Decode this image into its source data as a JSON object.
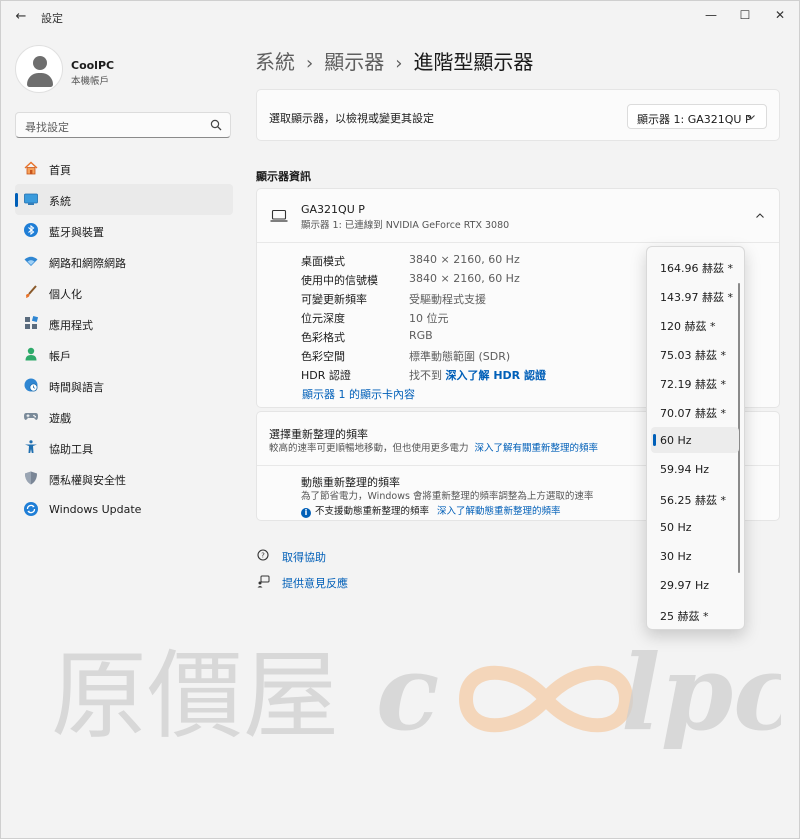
{
  "window": {
    "title": "設定"
  },
  "titlebar": {
    "back": "←",
    "minimize": "—",
    "maximize": "☐",
    "close": "✕"
  },
  "profile": {
    "name": "CoolPC",
    "subtitle": "本機帳戶"
  },
  "search": {
    "placeholder": "尋找設定"
  },
  "sidebar": {
    "items": [
      {
        "label": "首頁",
        "icon": "home-icon"
      },
      {
        "label": "系統",
        "icon": "system-icon"
      },
      {
        "label": "藍牙與裝置",
        "icon": "bluetooth-icon"
      },
      {
        "label": "網路和網際網路",
        "icon": "wifi-icon"
      },
      {
        "label": "個人化",
        "icon": "brush-icon"
      },
      {
        "label": "應用程式",
        "icon": "apps-icon"
      },
      {
        "label": "帳戶",
        "icon": "account-icon"
      },
      {
        "label": "時間與語言",
        "icon": "globe-clock-icon"
      },
      {
        "label": "遊戲",
        "icon": "gamepad-icon"
      },
      {
        "label": "協助工具",
        "icon": "accessibility-icon"
      },
      {
        "label": "隱私權與安全性",
        "icon": "shield-icon"
      },
      {
        "label": "Windows Update",
        "icon": "update-icon"
      }
    ],
    "active_index": 1
  },
  "breadcrumb": {
    "part1": "系統",
    "part2": "顯示器",
    "current": "進階型顯示器",
    "sep": "›"
  },
  "display_select": {
    "label": "選取顯示器，以檢視或變更其設定",
    "value": "顯示器 1: GA321QU P"
  },
  "section_title": "顯示器資訊",
  "monitor": {
    "name": "GA321QU P",
    "subtitle": "顯示器 1: 已連線到 NVIDIA GeForce RTX 3080",
    "rows": [
      {
        "key": "桌面模式",
        "value": "3840 × 2160, 60 Hz"
      },
      {
        "key": "使用中的信號模",
        "value": "3840 × 2160, 60 Hz"
      },
      {
        "key": "可變更新頻率",
        "value": "受驅動程式支援"
      },
      {
        "key": "位元深度",
        "value": "10 位元"
      },
      {
        "key": "色彩格式",
        "value": "RGB"
      },
      {
        "key": "色彩空間",
        "value": "標準動態範圍 (SDR)"
      },
      {
        "key": "HDR 認證",
        "value": "找不到",
        "link": "深入了解 HDR 認證"
      }
    ],
    "adapter_link": "顯示器 1 的顯示卡內容"
  },
  "refresh": {
    "title": "選擇重新整理的頻率",
    "desc": "較高的速率可更順暢地移動，但也使用更多電力",
    "desc_link": "深入了解有關重新整理的頻率",
    "dynamic_title": "動態重新整理的頻率",
    "dynamic_desc": "為了節省電力，Windows 會將重新整理的頻率調整為上方選取的速率",
    "dynamic_note": "不支援動態重新整理的頻率",
    "dynamic_note_link": "深入了解動態重新整理的頻率",
    "options": [
      "164.96 赫茲 *",
      "143.97 赫茲 *",
      "120 赫茲 *",
      "75.03 赫茲 *",
      "72.19 赫茲 *",
      "70.07 赫茲 *",
      "60 Hz",
      "59.94 Hz",
      "56.25 赫茲 *",
      "50 Hz",
      "30 Hz",
      "29.97 Hz",
      "25 赫茲 *"
    ],
    "selected_index": 6
  },
  "help": {
    "get_help": "取得協助",
    "feedback": "提供意見反應"
  },
  "watermark": {
    "text_cn": "原價屋",
    "text_en_1": "c",
    "text_en_2": "lpc"
  },
  "colors": {
    "accent": "#005fb8",
    "watermark": "#cfcfcf",
    "watermark_orange": "#f3c9a1"
  }
}
